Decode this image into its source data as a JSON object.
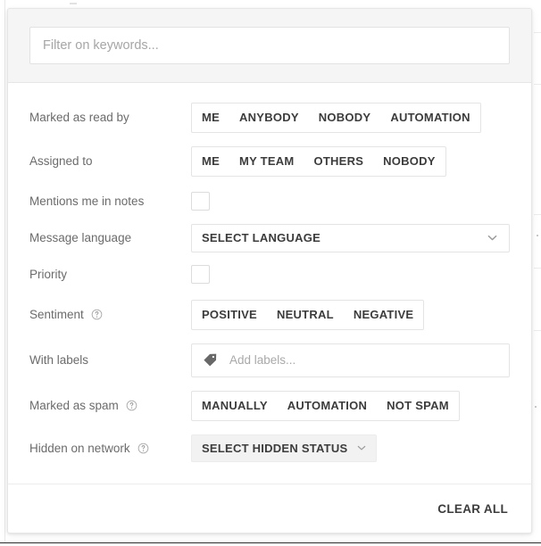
{
  "panel": {
    "search": {
      "placeholder": "Filter on keywords...",
      "value": ""
    },
    "rows": [
      {
        "label": "Marked as read by",
        "help": false,
        "type": "segmented",
        "options": [
          "ME",
          "ANYBODY",
          "NOBODY",
          "AUTOMATION"
        ]
      },
      {
        "label": "Assigned to",
        "help": false,
        "type": "segmented",
        "options": [
          "ME",
          "MY TEAM",
          "OTHERS",
          "NOBODY"
        ]
      },
      {
        "label": "Mentions me in notes",
        "help": false,
        "type": "checkbox",
        "checked": false
      },
      {
        "label": "Message language",
        "help": false,
        "type": "select",
        "value": "SELECT LANGUAGE"
      },
      {
        "label": "Priority",
        "help": false,
        "type": "checkbox",
        "checked": false
      },
      {
        "label": "Sentiment",
        "help": true,
        "type": "segmented",
        "options": [
          "POSITIVE",
          "NEUTRAL",
          "NEGATIVE"
        ]
      },
      {
        "label": "With labels",
        "help": false,
        "type": "labels",
        "placeholder": "Add labels...",
        "value": ""
      },
      {
        "label": "Marked as spam",
        "help": true,
        "type": "segmented",
        "options": [
          "MANUALLY",
          "AUTOMATION",
          "NOT SPAM"
        ]
      },
      {
        "label": "Hidden on network",
        "help": true,
        "type": "select-grey",
        "value": "SELECT HIDDEN STATUS"
      }
    ],
    "footer": {
      "clear_all_label": "CLEAR ALL"
    }
  },
  "icons": {
    "help": "help-circle-icon",
    "tag": "tag-icon",
    "chevron": "chevron-down-icon"
  },
  "colors": {
    "panel_bg": "#ffffff",
    "header_bg": "#f5f5f5",
    "border": "#e6e6e6",
    "label_text": "#6b6b6b",
    "button_text": "#3c3c3c",
    "placeholder": "#a6a6a6",
    "grey_fill": "#f2f2f2"
  }
}
